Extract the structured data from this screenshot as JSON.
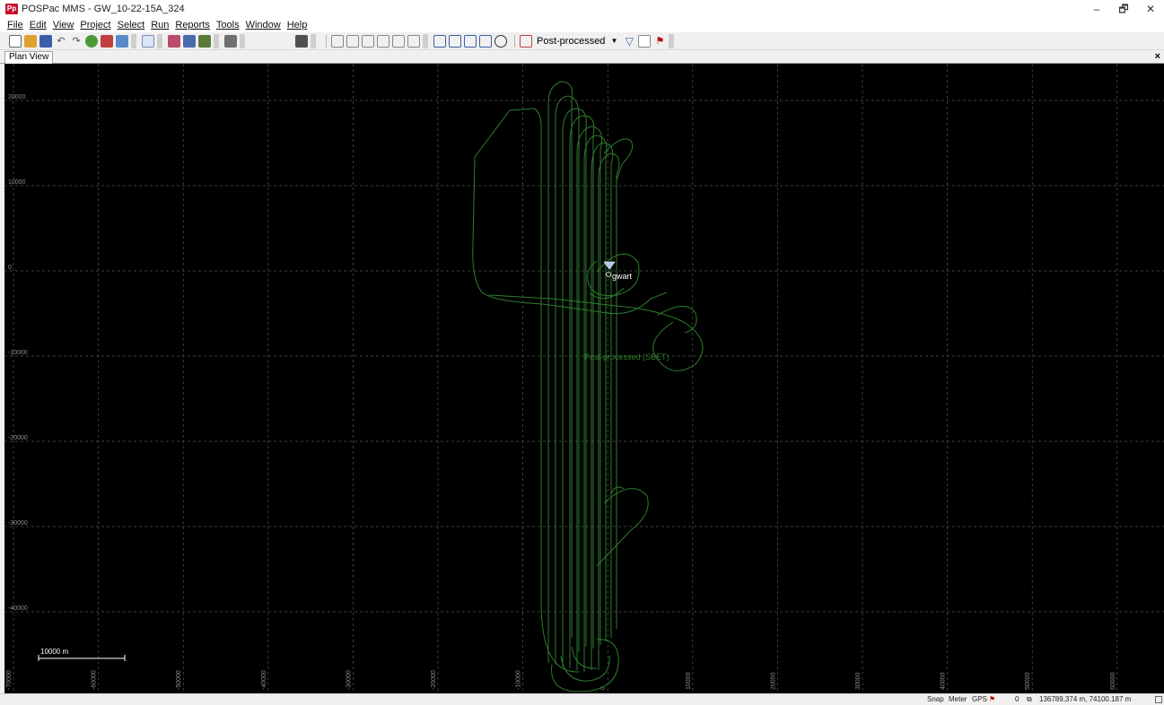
{
  "window": {
    "logo_text": "Pp",
    "title": "POSPac MMS - GW_10-22-15A_324",
    "controls": {
      "minimize": "–",
      "maximize": "🗗",
      "close": "✕"
    }
  },
  "menu": {
    "items": [
      "File",
      "Edit",
      "View",
      "Project",
      "Select",
      "Run",
      "Reports",
      "Tools",
      "Window",
      "Help"
    ]
  },
  "toolbar": {
    "solution_mode": "Post-processed",
    "icons": [
      "new-icon",
      "open-icon",
      "save-icon",
      "undo-icon",
      "redo-icon",
      "import-icon",
      "gnss-icon",
      "export-icon",
      "layers-icon",
      "station-icon",
      "copy-icon",
      "pen-icon",
      "arrow-icon",
      "camera-icon",
      "plot-icon",
      "chart-icon",
      "bars-icon",
      "map-icon",
      "image-icon",
      "scan-icon",
      "zoom-in-icon",
      "zoom-out-icon",
      "zoom-extent-icon",
      "pan-icon",
      "refresh-icon",
      "graph-icon",
      "filter-icon",
      "settings-icon",
      "flag-icon"
    ]
  },
  "tabs": {
    "active": "Plan View",
    "close_glyph": "×"
  },
  "plan_view": {
    "y_tick_labels": [
      "20000",
      "10000",
      "0",
      "-10000",
      "-20000",
      "-30000",
      "-40000"
    ],
    "x_tick_labels": [
      "-70000",
      "-60000",
      "-50000",
      "-40000",
      "-30000",
      "-20000",
      "-10000",
      "0",
      "10000",
      "20000",
      "30000",
      "40000",
      "50000",
      "60000"
    ],
    "base_station_label": "gwart",
    "trajectory_label": "Post-processed (SBET)",
    "scale_bar_label": "10000 m",
    "colors": {
      "background": "#000000",
      "grid": "#555555",
      "trajectory": "#2e7d2e",
      "label": "#8a8a8a"
    }
  },
  "statusbar": {
    "snap": "Snap",
    "units": "Meter",
    "time": "GPS",
    "count": "0",
    "coordinates": "136789.374 m, 74100.187 m"
  }
}
